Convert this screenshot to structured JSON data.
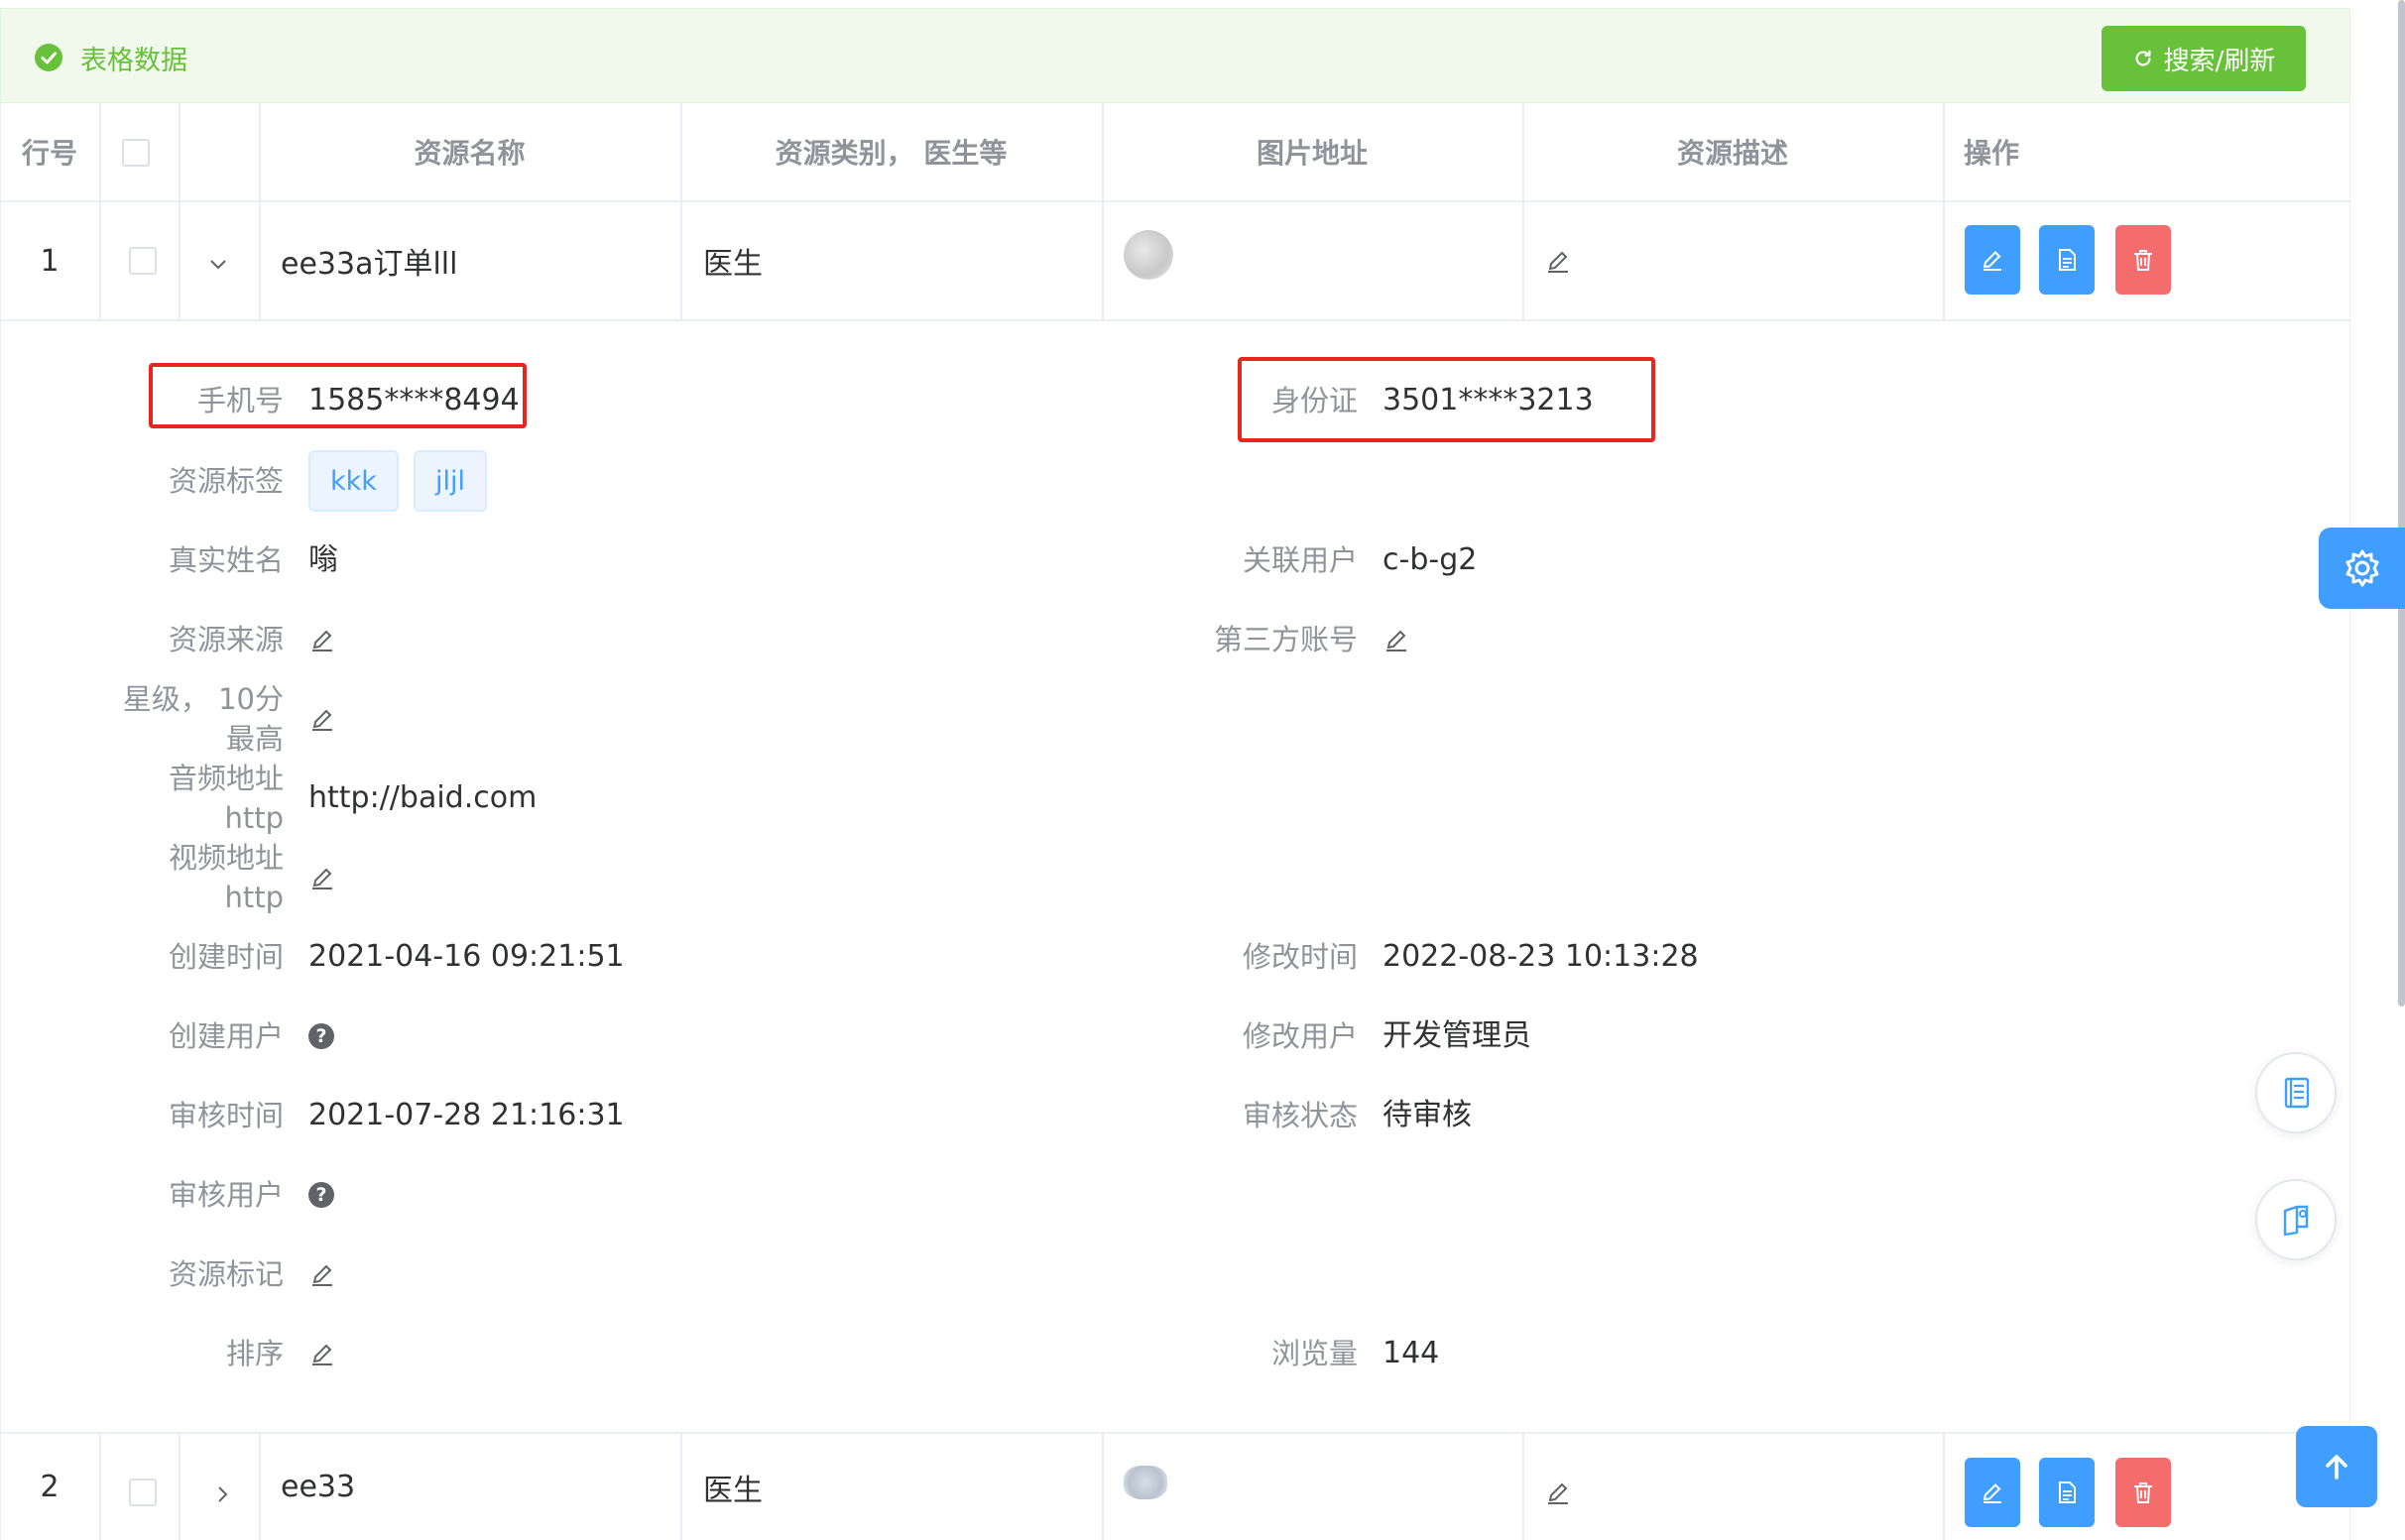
{
  "header": {
    "title": "表格数据",
    "refresh_label": "搜索/刷新"
  },
  "columns": {
    "row_no": "行号",
    "name": "资源名称",
    "category": "资源类别， 医生等",
    "image": "图片地址",
    "description": "资源描述",
    "actions": "操作"
  },
  "rows": [
    {
      "no": "1",
      "name": "ee33a订单lll",
      "category": "医生",
      "expanded": true
    },
    {
      "no": "2",
      "name": "ee33",
      "category": "医生",
      "expanded": false
    }
  ],
  "detail": {
    "phone_label": "手机号",
    "phone_value": "1585****8494",
    "idcard_label": "身份证",
    "idcard_value": "3501****3213",
    "tags_label": "资源标签",
    "tags": [
      "kkk",
      "jljl"
    ],
    "realname_label": "真实姓名",
    "realname_value": "嗡",
    "linked_user_label": "关联用户",
    "linked_user_value": "c-b-g2",
    "source_label": "资源来源",
    "third_account_label": "第三方账号",
    "star_label_1": "星级， 10分",
    "star_label_2": "最高",
    "audio_label_1": "音频地址",
    "audio_label_2": "http",
    "audio_value": "http://baid.com",
    "video_label_1": "视频地址",
    "video_label_2": "http",
    "created_time_label": "创建时间",
    "created_time_value": "2021-04-16 09:21:51",
    "modified_time_label": "修改时间",
    "modified_time_value": "2022-08-23 10:13:28",
    "created_user_label": "创建用户",
    "modified_user_label": "修改用户",
    "modified_user_value": "开发管理员",
    "audit_time_label": "审核时间",
    "audit_time_value": "2021-07-28 21:16:31",
    "audit_status_label": "审核状态",
    "audit_status_value": "待审核",
    "audit_user_label": "审核用户",
    "resource_mark_label": "资源标记",
    "sort_label": "排序",
    "views_label": "浏览量",
    "views_value": "144",
    "question_mark": "?"
  },
  "colors": {
    "success": "#67c23a",
    "primary": "#409eff",
    "danger": "#f56c6c",
    "highlight": "#e8261f"
  }
}
